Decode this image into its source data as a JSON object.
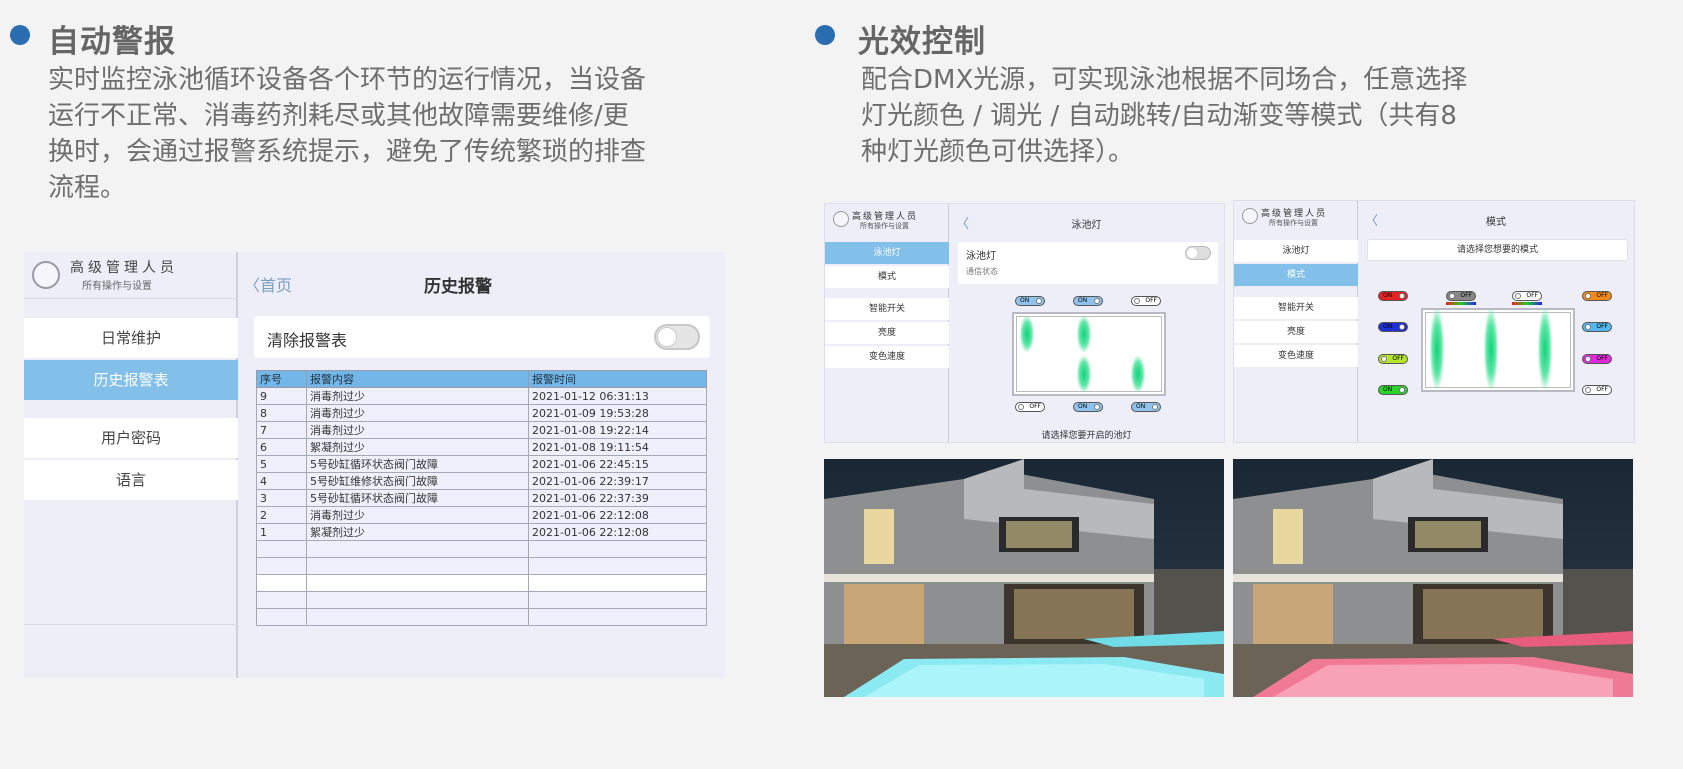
{
  "left": {
    "heading": "自动警报",
    "desc_lines": [
      "实时监控泳池循环设备各个环节的运行情况，当设备",
      "运行不正常、消毒药剂耗尽或其他故障需要维修/更",
      "换时，会通过报警系统提示，避免了传统繁琐的排查",
      "流程。"
    ],
    "panel": {
      "user_name": "高级管理人员",
      "user_role": "所有操作与设置",
      "menu": [
        "日常维护",
        "历史报警表",
        "用户密码",
        "语言"
      ],
      "back_label": "首页",
      "title": "历史报警",
      "clear_label": "清除报警表",
      "table": {
        "headers": [
          "序号",
          "报警内容",
          "报警时间"
        ],
        "rows": [
          [
            "9",
            "消毒剂过少",
            "2021-01-12 06:31:13"
          ],
          [
            "8",
            "消毒剂过少",
            "2021-01-09 19:53:28"
          ],
          [
            "7",
            "消毒剂过少",
            "2021-01-08 19:22:14"
          ],
          [
            "6",
            "絮凝剂过少",
            "2021-01-08 19:11:54"
          ],
          [
            "5",
            "5号砂缸循环状态阀门故障",
            "2021-01-06 22:45:15"
          ],
          [
            "4",
            "5号砂缸维修状态阀门故障",
            "2021-01-06 22:39:17"
          ],
          [
            "3",
            "5号砂缸循环状态阀门故障",
            "2021-01-06 22:37:39"
          ],
          [
            "2",
            "消毒剂过少",
            "2021-01-06 22:12:08"
          ],
          [
            "1",
            "絮凝剂过少",
            "2021-01-06 22:12:08"
          ]
        ]
      }
    }
  },
  "right": {
    "heading": "光效控制",
    "desc_lines": [
      "配合DMX光源，可实现泳池根据不同场合，任意选择",
      "灯光颜色 / 调光 / 自动跳转/自动渐变等模式（共有8",
      "种灯光颜色可供选择）。"
    ],
    "panel1": {
      "user_name": "高级管理人员",
      "user_role": "所有操作与设置",
      "menu": [
        "泳池灯",
        "模式",
        "智能开关",
        "亮度",
        "变色速度"
      ],
      "title": "泳池灯",
      "card_title": "泳池灯",
      "card_status": "通信状态",
      "switch_on": "ON",
      "switch_off": "OFF",
      "footer": "请选择您要开启的池灯"
    },
    "panel2": {
      "user_name": "高级管理人员",
      "user_role": "所有操作与设置",
      "menu": [
        "泳池灯",
        "模式",
        "智能开关",
        "亮度",
        "变色速度"
      ],
      "title": "模式",
      "hint": "请选择您想要的模式",
      "switch_on": "ON",
      "switch_off": "OFF",
      "colors": {
        "red": "#e52222",
        "orange": "#f28a1a",
        "blue": "#1f2fd6",
        "skyblue": "#54b8ef",
        "lime": "#b6e62a",
        "magenta": "#e02ad8",
        "green": "#2ad42a",
        "white": "#ffffff"
      }
    },
    "photo_water": {
      "cyan": "#7fe6f0",
      "red": "#f06a8c"
    }
  }
}
